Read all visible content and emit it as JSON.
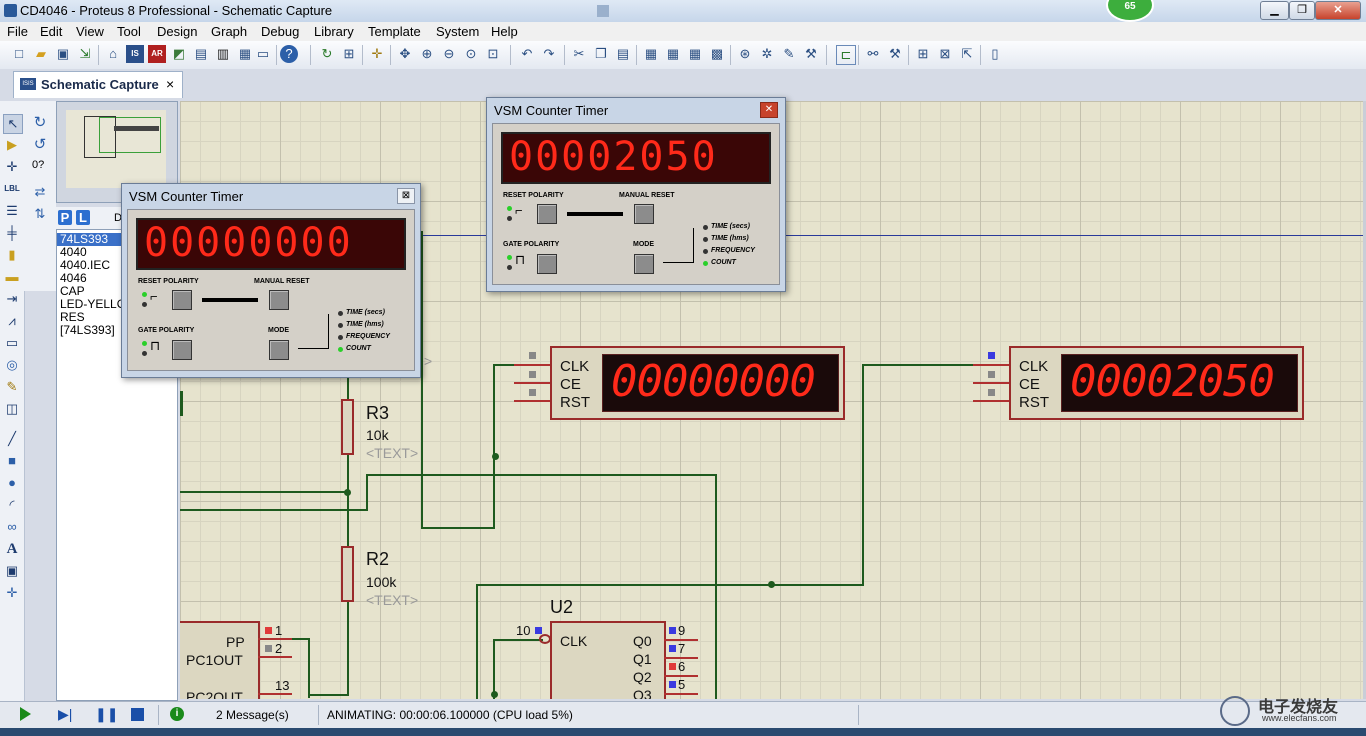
{
  "window": {
    "title": "CD4046 - Proteus 8 Professional - Schematic Capture",
    "badge": "65",
    "min_label": "▁",
    "max_label": "❐",
    "close_label": "✕"
  },
  "menu": [
    "File",
    "Edit",
    "View",
    "Tool",
    "Design",
    "Graph",
    "Debug",
    "Library",
    "Template",
    "System",
    "Help"
  ],
  "tab": {
    "label": "Schematic Capture",
    "close": "×",
    "icon_label": "ISIS"
  },
  "toolbox2": {
    "rotate_text": "0?"
  },
  "device_panel": {
    "p_label": "P",
    "l_label": "L",
    "extra": "D",
    "items": [
      "74LS393",
      "4040",
      "4040.IEC",
      "4046",
      "CAP",
      "LED-YELLOW",
      "RES",
      "[74LS393]"
    ]
  },
  "popup_small": {
    "title": "VSM Counter Timer",
    "close": "⊠",
    "display": "00000000",
    "reset_polarity": "RESET POLARITY",
    "manual_reset": "MANUAL RESET",
    "gate_polarity": "GATE POLARITY",
    "mode": "MODE",
    "modes": [
      "TIME (secs)",
      "TIME (hms)",
      "FREQUENCY",
      "COUNT"
    ]
  },
  "popup_large": {
    "title": "VSM Counter Timer",
    "close": "✕",
    "display": "00002050",
    "reset_polarity": "RESET POLARITY",
    "manual_reset": "MANUAL RESET",
    "gate_polarity": "GATE POLARITY",
    "mode": "MODE",
    "modes": [
      "TIME (secs)",
      "TIME (hms)",
      "FREQUENCY",
      "COUNT"
    ]
  },
  "schematic": {
    "counter1": {
      "pins": [
        "CLK",
        "CE",
        "RST"
      ],
      "display": "00000000"
    },
    "counter2": {
      "pins": [
        "CLK",
        "CE",
        "RST"
      ],
      "display": "00002050"
    },
    "r3": {
      "ref": "R3",
      "value": "10k",
      "text": "<TEXT>"
    },
    "r2": {
      "ref": "R2",
      "value": "100k",
      "text": "<TEXT>"
    },
    "u2": {
      "ref": "U2",
      "clk": "CLK",
      "clk_pin": "10",
      "outputs": [
        "Q0",
        "Q1",
        "Q2",
        "Q3"
      ],
      "output_pins": [
        "9",
        "7",
        "6",
        "5"
      ]
    },
    "left_chip": {
      "labels": [
        "PP",
        "PC1OUT",
        "PC2OUT"
      ],
      "pins": [
        "1",
        "2",
        "13"
      ]
    },
    "stray_text": ">"
  },
  "status": {
    "messages": "2 Message(s)",
    "animating": "ANIMATING: 00:00:06.100000 (CPU load 5%)",
    "watermark": "电子发烧友",
    "watermark_url": "www.elecfans.com"
  },
  "colors": {
    "grid_bg": "#e6e3cd",
    "wire": "#1e5a1e",
    "segment_red": "#ff2a1a",
    "component_border": "#9a2a2a"
  }
}
